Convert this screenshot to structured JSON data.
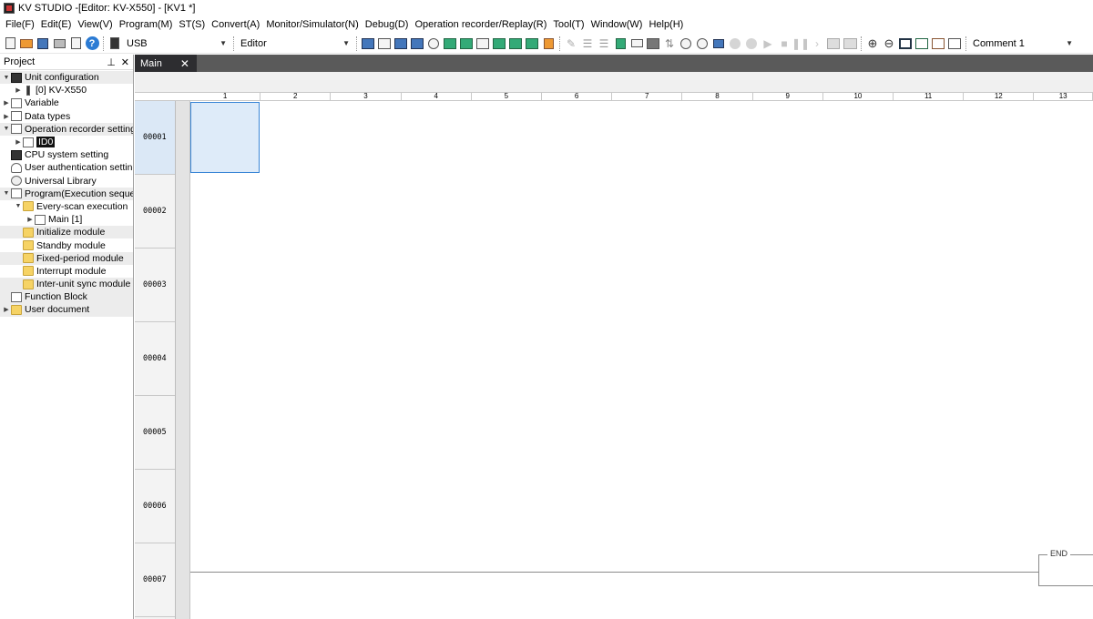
{
  "window": {
    "title": "KV STUDIO -[Editor: KV-X550] - [KV1 *]"
  },
  "menu": [
    "File(F)",
    "Edit(E)",
    "View(V)",
    "Program(M)",
    "ST(S)",
    "Convert(A)",
    "Monitor/Simulator(N)",
    "Debug(D)",
    "Operation recorder/Replay(R)",
    "Tool(T)",
    "Window(W)",
    "Help(H)"
  ],
  "toolbar": {
    "connection": "USB",
    "mode": "Editor",
    "comment": "Comment 1",
    "help_glyph": "?"
  },
  "project": {
    "title": "Project",
    "pin_glyph": "⊥",
    "close_glyph": "✕",
    "items": [
      {
        "label": "Unit configuration",
        "level": 0,
        "toggle": "▼",
        "icon": "dark"
      },
      {
        "label": "[0]  KV-X550",
        "level": 1,
        "toggle": "▶",
        "icon": "slim"
      },
      {
        "label": "Variable",
        "level": 0,
        "toggle": "▶",
        "icon": "doc"
      },
      {
        "label": "Data types",
        "level": 0,
        "toggle": "▶",
        "icon": "doc"
      },
      {
        "label": "Operation recorder setting",
        "level": 0,
        "toggle": "▼",
        "icon": "doc"
      },
      {
        "label": "ID0",
        "level": 1,
        "toggle": "▶",
        "icon": "doc",
        "selected": true
      },
      {
        "label": "CPU system setting",
        "level": 0,
        "toggle": "",
        "icon": "dark"
      },
      {
        "label": "User authentication setting",
        "level": 0,
        "toggle": "",
        "icon": "user"
      },
      {
        "label": "Universal Library",
        "level": 0,
        "toggle": "",
        "icon": "lib"
      },
      {
        "label": "Program(Execution sequence)",
        "level": 0,
        "toggle": "▼",
        "icon": "doc"
      },
      {
        "label": "Every-scan execution",
        "level": 1,
        "toggle": "▼",
        "icon": "folder"
      },
      {
        "label": "Main [1]",
        "level": 2,
        "toggle": "▶",
        "icon": "doc"
      },
      {
        "label": "Initialize module",
        "level": 1,
        "toggle": "",
        "icon": "folder"
      },
      {
        "label": "Standby module",
        "level": 1,
        "toggle": "",
        "icon": "folder"
      },
      {
        "label": "Fixed-period module",
        "level": 1,
        "toggle": "",
        "icon": "folder"
      },
      {
        "label": "Interrupt module",
        "level": 1,
        "toggle": "",
        "icon": "folder"
      },
      {
        "label": "Inter-unit sync module",
        "level": 1,
        "toggle": "",
        "icon": "folder"
      },
      {
        "label": "Function Block",
        "level": 0,
        "toggle": "",
        "icon": "doc"
      },
      {
        "label": "User document",
        "level": 0,
        "toggle": "▶",
        "icon": "folder"
      }
    ]
  },
  "editor": {
    "tab_label": "Main",
    "tab_close": "✕",
    "columns": [
      "1",
      "2",
      "3",
      "4",
      "5",
      "6",
      "7",
      "8",
      "9",
      "10",
      "11",
      "12",
      "13"
    ],
    "rows": [
      "00001",
      "00002",
      "00003",
      "00004",
      "00005",
      "00006",
      "00007"
    ],
    "end_label": "END"
  }
}
